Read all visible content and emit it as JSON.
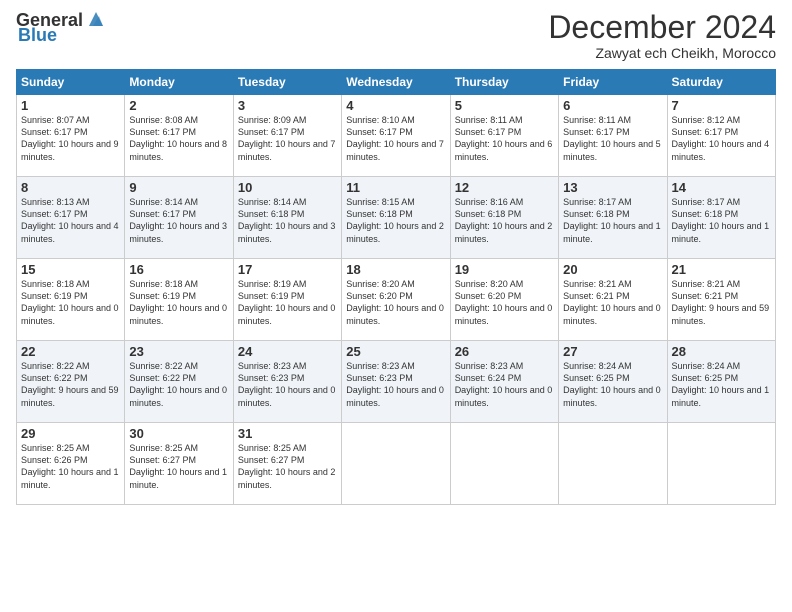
{
  "header": {
    "logo_general": "General",
    "logo_blue": "Blue",
    "month_title": "December 2024",
    "location": "Zawyat ech Cheikh, Morocco"
  },
  "columns": [
    "Sunday",
    "Monday",
    "Tuesday",
    "Wednesday",
    "Thursday",
    "Friday",
    "Saturday"
  ],
  "weeks": [
    [
      {
        "day": "1",
        "sunrise": "Sunrise: 8:07 AM",
        "sunset": "Sunset: 6:17 PM",
        "daylight": "Daylight: 10 hours and 9 minutes."
      },
      {
        "day": "2",
        "sunrise": "Sunrise: 8:08 AM",
        "sunset": "Sunset: 6:17 PM",
        "daylight": "Daylight: 10 hours and 8 minutes."
      },
      {
        "day": "3",
        "sunrise": "Sunrise: 8:09 AM",
        "sunset": "Sunset: 6:17 PM",
        "daylight": "Daylight: 10 hours and 7 minutes."
      },
      {
        "day": "4",
        "sunrise": "Sunrise: 8:10 AM",
        "sunset": "Sunset: 6:17 PM",
        "daylight": "Daylight: 10 hours and 7 minutes."
      },
      {
        "day": "5",
        "sunrise": "Sunrise: 8:11 AM",
        "sunset": "Sunset: 6:17 PM",
        "daylight": "Daylight: 10 hours and 6 minutes."
      },
      {
        "day": "6",
        "sunrise": "Sunrise: 8:11 AM",
        "sunset": "Sunset: 6:17 PM",
        "daylight": "Daylight: 10 hours and 5 minutes."
      },
      {
        "day": "7",
        "sunrise": "Sunrise: 8:12 AM",
        "sunset": "Sunset: 6:17 PM",
        "daylight": "Daylight: 10 hours and 4 minutes."
      }
    ],
    [
      {
        "day": "8",
        "sunrise": "Sunrise: 8:13 AM",
        "sunset": "Sunset: 6:17 PM",
        "daylight": "Daylight: 10 hours and 4 minutes."
      },
      {
        "day": "9",
        "sunrise": "Sunrise: 8:14 AM",
        "sunset": "Sunset: 6:17 PM",
        "daylight": "Daylight: 10 hours and 3 minutes."
      },
      {
        "day": "10",
        "sunrise": "Sunrise: 8:14 AM",
        "sunset": "Sunset: 6:18 PM",
        "daylight": "Daylight: 10 hours and 3 minutes."
      },
      {
        "day": "11",
        "sunrise": "Sunrise: 8:15 AM",
        "sunset": "Sunset: 6:18 PM",
        "daylight": "Daylight: 10 hours and 2 minutes."
      },
      {
        "day": "12",
        "sunrise": "Sunrise: 8:16 AM",
        "sunset": "Sunset: 6:18 PM",
        "daylight": "Daylight: 10 hours and 2 minutes."
      },
      {
        "day": "13",
        "sunrise": "Sunrise: 8:17 AM",
        "sunset": "Sunset: 6:18 PM",
        "daylight": "Daylight: 10 hours and 1 minute."
      },
      {
        "day": "14",
        "sunrise": "Sunrise: 8:17 AM",
        "sunset": "Sunset: 6:18 PM",
        "daylight": "Daylight: 10 hours and 1 minute."
      }
    ],
    [
      {
        "day": "15",
        "sunrise": "Sunrise: 8:18 AM",
        "sunset": "Sunset: 6:19 PM",
        "daylight": "Daylight: 10 hours and 0 minutes."
      },
      {
        "day": "16",
        "sunrise": "Sunrise: 8:18 AM",
        "sunset": "Sunset: 6:19 PM",
        "daylight": "Daylight: 10 hours and 0 minutes."
      },
      {
        "day": "17",
        "sunrise": "Sunrise: 8:19 AM",
        "sunset": "Sunset: 6:19 PM",
        "daylight": "Daylight: 10 hours and 0 minutes."
      },
      {
        "day": "18",
        "sunrise": "Sunrise: 8:20 AM",
        "sunset": "Sunset: 6:20 PM",
        "daylight": "Daylight: 10 hours and 0 minutes."
      },
      {
        "day": "19",
        "sunrise": "Sunrise: 8:20 AM",
        "sunset": "Sunset: 6:20 PM",
        "daylight": "Daylight: 10 hours and 0 minutes."
      },
      {
        "day": "20",
        "sunrise": "Sunrise: 8:21 AM",
        "sunset": "Sunset: 6:21 PM",
        "daylight": "Daylight: 10 hours and 0 minutes."
      },
      {
        "day": "21",
        "sunrise": "Sunrise: 8:21 AM",
        "sunset": "Sunset: 6:21 PM",
        "daylight": "Daylight: 9 hours and 59 minutes."
      }
    ],
    [
      {
        "day": "22",
        "sunrise": "Sunrise: 8:22 AM",
        "sunset": "Sunset: 6:22 PM",
        "daylight": "Daylight: 9 hours and 59 minutes."
      },
      {
        "day": "23",
        "sunrise": "Sunrise: 8:22 AM",
        "sunset": "Sunset: 6:22 PM",
        "daylight": "Daylight: 10 hours and 0 minutes."
      },
      {
        "day": "24",
        "sunrise": "Sunrise: 8:23 AM",
        "sunset": "Sunset: 6:23 PM",
        "daylight": "Daylight: 10 hours and 0 minutes."
      },
      {
        "day": "25",
        "sunrise": "Sunrise: 8:23 AM",
        "sunset": "Sunset: 6:23 PM",
        "daylight": "Daylight: 10 hours and 0 minutes."
      },
      {
        "day": "26",
        "sunrise": "Sunrise: 8:23 AM",
        "sunset": "Sunset: 6:24 PM",
        "daylight": "Daylight: 10 hours and 0 minutes."
      },
      {
        "day": "27",
        "sunrise": "Sunrise: 8:24 AM",
        "sunset": "Sunset: 6:25 PM",
        "daylight": "Daylight: 10 hours and 0 minutes."
      },
      {
        "day": "28",
        "sunrise": "Sunrise: 8:24 AM",
        "sunset": "Sunset: 6:25 PM",
        "daylight": "Daylight: 10 hours and 1 minute."
      }
    ],
    [
      {
        "day": "29",
        "sunrise": "Sunrise: 8:25 AM",
        "sunset": "Sunset: 6:26 PM",
        "daylight": "Daylight: 10 hours and 1 minute."
      },
      {
        "day": "30",
        "sunrise": "Sunrise: 8:25 AM",
        "sunset": "Sunset: 6:27 PM",
        "daylight": "Daylight: 10 hours and 1 minute."
      },
      {
        "day": "31",
        "sunrise": "Sunrise: 8:25 AM",
        "sunset": "Sunset: 6:27 PM",
        "daylight": "Daylight: 10 hours and 2 minutes."
      },
      null,
      null,
      null,
      null
    ]
  ]
}
